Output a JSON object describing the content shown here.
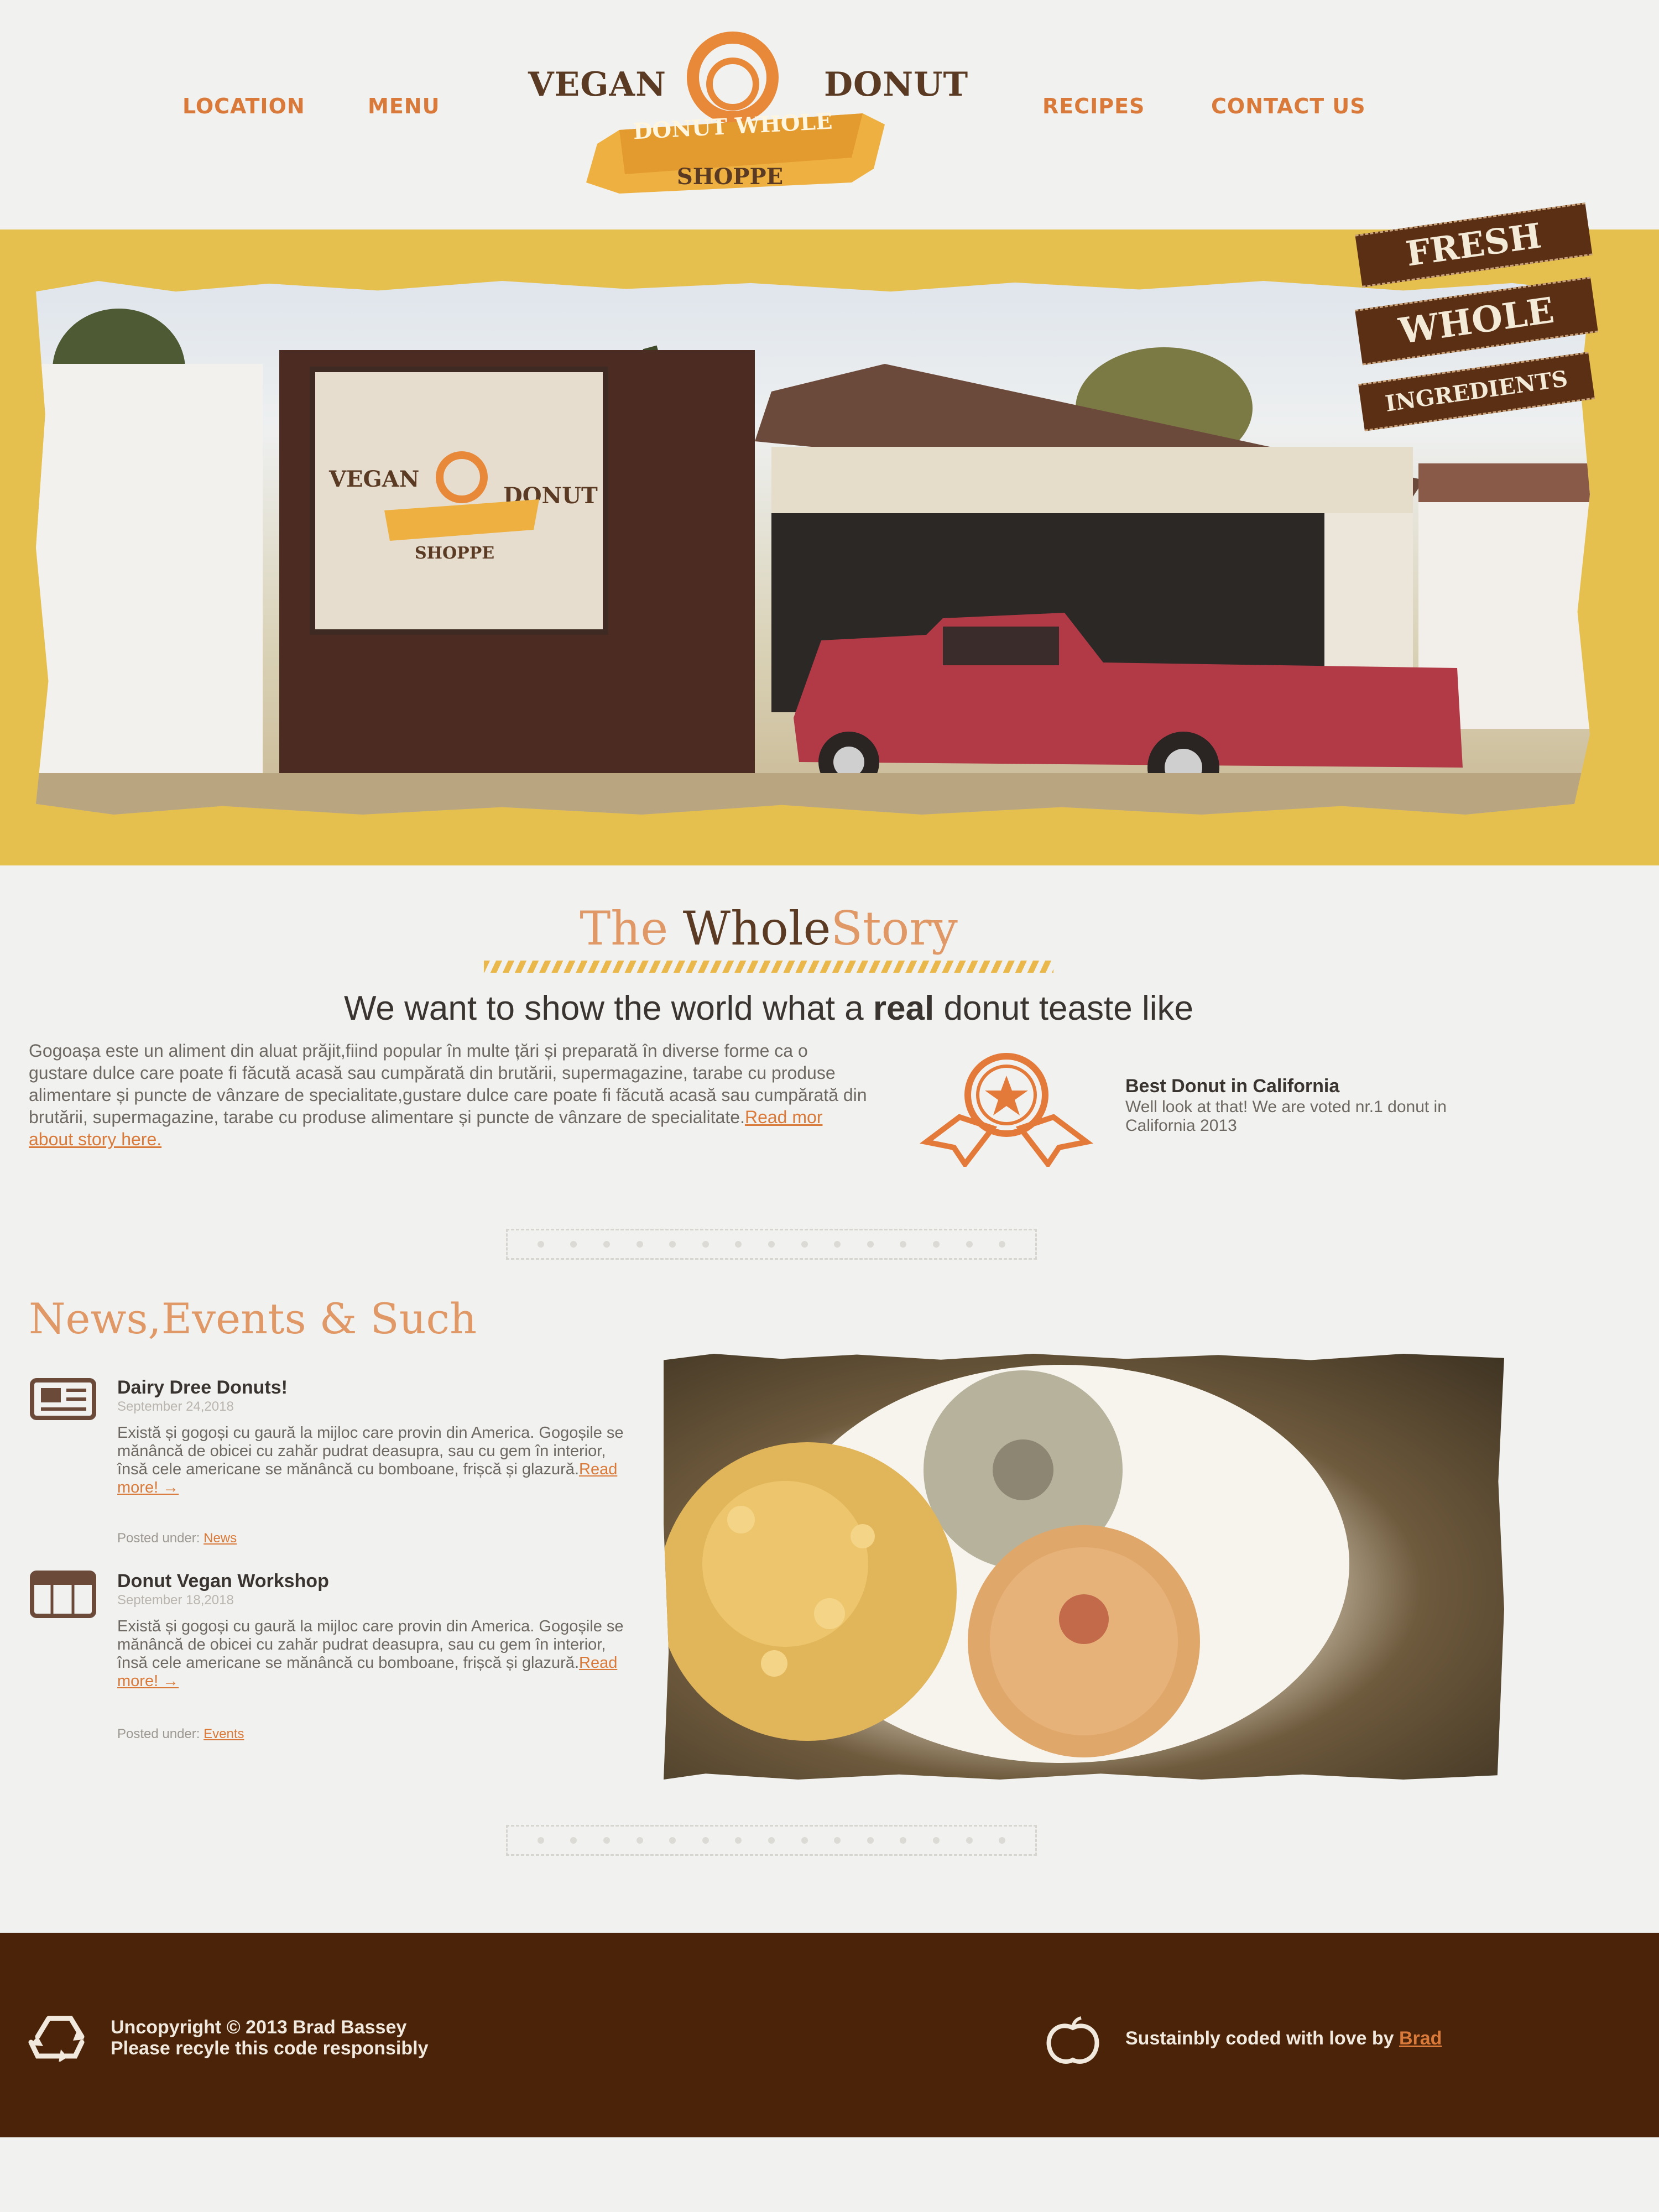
{
  "header": {
    "nav": [
      "LOCATION",
      "MENU",
      "RECIPES",
      "CONTACT US"
    ],
    "logo": {
      "left_word": "VEGAN",
      "right_word": "DONUT",
      "banner": "DONUT WHOLE",
      "sub": "SHOPPE"
    }
  },
  "hero": {
    "ribbons": [
      "FRESH",
      "WHOLE",
      "INGREDIENTS"
    ],
    "sign": {
      "left_word": "VEGAN",
      "right_word": "DONUT",
      "sub": "SHOPPE"
    }
  },
  "story": {
    "title_part1": "The ",
    "title_part2": "Whole",
    "title_part3": "Story",
    "headline_pre": "We want to show the world what a ",
    "headline_bold": "real",
    "headline_post": " donut teaste like",
    "body": "Gogoașa este un aliment din aluat prăjit,fiind popular în multe țări și preparată în diverse forme ca o gustare dulce care poate fi făcută acasă sau cumpărată din brutării, supermagazine, tarabe cu produse alimentare și puncte de vânzare de specialitate,gustare dulce care poate fi făcută acasă sau cumpărată din brutării, supermagazine, tarabe cu produse alimentare și puncte de vânzare de specialitate.",
    "read_more": "Read mor about story here.",
    "award": {
      "title": "Best Donut in California",
      "text": "Well look at that! We are voted nr.1 donut in California 2013"
    }
  },
  "news": {
    "title": "News,Events & Such",
    "items": [
      {
        "icon": "news-icon",
        "title": "Dairy Dree Donuts!",
        "date": "September 24,2018",
        "body": "Există și gogoși cu gaură la mijloc care provin din America. Gogoșile se mănâncă de obicei cu zahăr pudrat deasupra, sau cu gem în interior, însă cele americane se mănâncă cu bomboane, frișcă și glazură.",
        "read_more": "Read more! →",
        "posted_label": "Posted under: ",
        "posted_link": "News"
      },
      {
        "icon": "calendar-icon",
        "title": "Donut Vegan Workshop",
        "date": "September 18,2018",
        "body": "Există și gogoși cu gaură la mijloc care provin din America. Gogoșile se mănâncă de obicei cu zahăr pudrat deasupra, sau cu gem în interior, însă cele americane se mănâncă cu bomboane, frișcă și glazură.",
        "read_more": "Read more! →",
        "posted_label": "Posted under: ",
        "posted_link": "Events"
      }
    ]
  },
  "footer": {
    "copyright_line1_pre": "Uncopyright © 2013 ",
    "copyright_author": "Brad Bassey",
    "copyright_line2": "Please recyle this code responsibly",
    "credit_pre": "Sustainbly coded with love by ",
    "credit_link": "Brad"
  },
  "colors": {
    "accent": "#d97a3a",
    "mustard": "#e6c04f",
    "footer": "#4a2308",
    "brown": "#5a2f14"
  }
}
